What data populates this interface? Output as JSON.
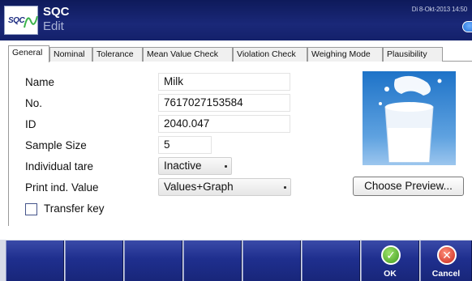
{
  "header": {
    "logo_text": "SQC",
    "title": "SQC",
    "subtitle": "Edit",
    "datetime": "Di 8-Okt-2013 14:50"
  },
  "tabs": [
    {
      "label": "General",
      "active": true
    },
    {
      "label": "Nominal",
      "active": false
    },
    {
      "label": "Tolerance",
      "active": false
    },
    {
      "label": "Mean Value Check",
      "active": false
    },
    {
      "label": "Violation Check",
      "active": false
    },
    {
      "label": "Weighing Mode",
      "active": false
    },
    {
      "label": "Plausibility",
      "active": false
    }
  ],
  "form": {
    "name_label": "Name",
    "name_value": "Milk",
    "no_label": "No.",
    "no_value": "7617027153584",
    "id_label": "ID",
    "id_value": "2040.047",
    "sample_size_label": "Sample Size",
    "sample_size_value": "5",
    "individual_tare_label": "Individual tare",
    "individual_tare_value": "Inactive",
    "print_ind_value_label": "Print ind. Value",
    "print_ind_value_value": "Values+Graph",
    "transfer_key_label": "Transfer key",
    "transfer_key_checked": false
  },
  "preview": {
    "choose_label": "Choose Preview..."
  },
  "bottom_bar": {
    "ok_label": "OK",
    "cancel_label": "Cancel",
    "ok_icon": "check-icon",
    "cancel_icon": "x-icon"
  },
  "colors": {
    "header_bg": "#14216b",
    "fkey_bg": "#1f2f8e",
    "ok_green": "#3f9a1e",
    "cancel_red": "#c8261a"
  }
}
